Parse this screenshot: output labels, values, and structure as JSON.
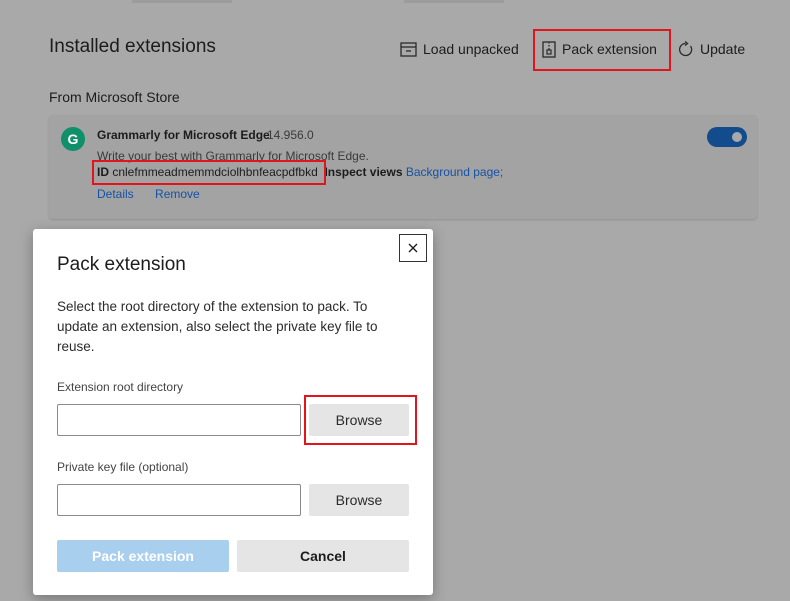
{
  "header": {
    "title": "Installed extensions",
    "load_unpacked": "Load unpacked",
    "pack_extension": "Pack extension",
    "update": "Update"
  },
  "section": {
    "label": "From Microsoft Store"
  },
  "extension": {
    "name": "Grammarly for Microsoft Edge",
    "version": "14.956.0",
    "description": "Write your best with Grammarly for Microsoft Edge.",
    "id_label": "ID",
    "id_value": "cnlefmmeadmemmdciolhbnfeacpdfbkd",
    "inspect_label": "Inspect views",
    "background_page": "Background page;",
    "details": "Details",
    "remove": "Remove",
    "enabled": true,
    "logo_letter": "G",
    "logo_color": "#0f8f6a",
    "toggle_color": "#124c8c"
  },
  "dialog": {
    "title": "Pack extension",
    "description": "Select the root directory of the extension to pack. To update an extension, also select the private key file to reuse.",
    "root_label": "Extension root directory",
    "root_value": "",
    "key_label": "Private key file (optional)",
    "key_value": "",
    "browse": "Browse",
    "pack_button": "Pack extension",
    "cancel_button": "Cancel",
    "close_icon": "close-icon"
  },
  "colors": {
    "highlight": "#e0161c",
    "link": "#1652a6",
    "primary_disabled": "#a9cfee"
  }
}
